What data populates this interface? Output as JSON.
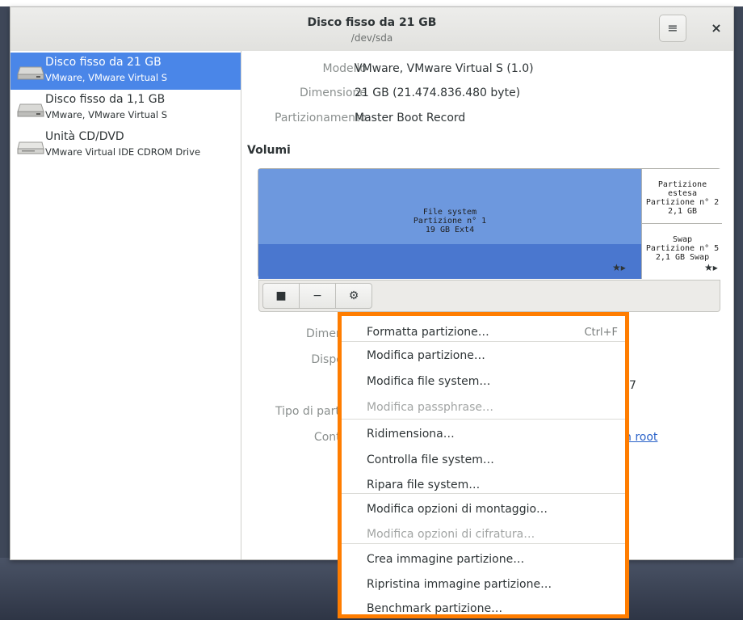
{
  "window": {
    "title": "Disco fisso da 21 GB",
    "subtitle": "/dev/sda",
    "menu_icon": "hamburger-menu-icon",
    "close_icon": "close-icon",
    "menu_glyph": "≡",
    "close_glyph": "×"
  },
  "sidebar": {
    "drives": [
      {
        "name": "Disco fisso da 21 GB",
        "desc": "VMware, VMware Virtual S",
        "icon": "hard-disk-icon",
        "selected": true
      },
      {
        "name": "Disco fisso da 1,1 GB",
        "desc": "VMware, VMware Virtual S",
        "icon": "hard-disk-icon",
        "selected": false
      },
      {
        "name": "Unità CD/DVD",
        "desc": "VMware Virtual IDE CDROM Drive",
        "icon": "optical-drive-icon",
        "selected": false
      }
    ]
  },
  "disk_info": {
    "model_label": "Modello",
    "model_value": "VMware, VMware Virtual S (1.0)",
    "size_label": "Dimensione",
    "size_value": "21 GB (21.474.836.480 byte)",
    "partitioning_label": "Partizionamento",
    "partitioning_value": "Master Boot Record"
  },
  "volumes": {
    "title": "Volumi",
    "partition1": {
      "line1": "File system",
      "line2": "Partizione n° 1",
      "line3": "19 GB Ext4"
    },
    "extended": {
      "line1": "Partizione estesa",
      "line2": "Partizione n° 2",
      "line3": "2,1 GB"
    },
    "swap": {
      "line1": "Swap",
      "line2": "Partizione n° 5",
      "line3": "2,1 GB Swap"
    },
    "marker": "★▸",
    "toolbar": {
      "stop": "■",
      "minus": "−",
      "gear": "⚙"
    }
  },
  "partition_details": {
    "size_label": "Dimensi",
    "device_label": "Disposi",
    "uuid_label": "U",
    "type_label": "Tipo di partizi",
    "contents_label": "Conter",
    "contents_link_tail": "n root",
    "uuid_tail": "7"
  },
  "context_menu": {
    "items": [
      {
        "label": "Formatta partizione…",
        "shortcut": "Ctrl+F",
        "disabled": false
      },
      {
        "label": "Modifica partizione…",
        "shortcut": "",
        "disabled": false
      },
      {
        "label": "Modifica file system…",
        "shortcut": "",
        "disabled": false
      },
      {
        "label": "Modifica passphrase…",
        "shortcut": "",
        "disabled": true
      },
      {
        "label": "Ridimensiona…",
        "shortcut": "",
        "disabled": false
      },
      {
        "label": "Controlla file system…",
        "shortcut": "",
        "disabled": false
      },
      {
        "label": "Ripara file system…",
        "shortcut": "",
        "disabled": false
      },
      {
        "label": "Modifica opzioni di montaggio…",
        "shortcut": "",
        "disabled": false
      },
      {
        "label": "Modifica opzioni di cifratura…",
        "shortcut": "",
        "disabled": true
      },
      {
        "label": "Crea immagine partizione…",
        "shortcut": "",
        "disabled": false
      },
      {
        "label": "Ripristina immagine partizione…",
        "shortcut": "",
        "disabled": false
      },
      {
        "label": "Benchmark partizione…",
        "shortcut": "",
        "disabled": false
      }
    ]
  },
  "colors": {
    "selection": "#4a86e8",
    "highlight_border": "#ff7d00",
    "partition_top": "#6d98de",
    "partition_bottom": "#4a77cf"
  }
}
